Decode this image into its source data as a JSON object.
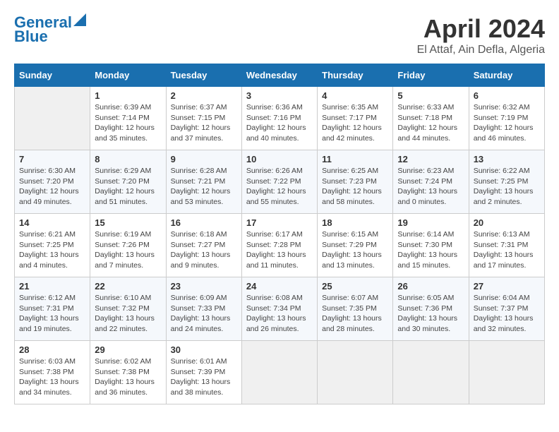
{
  "header": {
    "logo_line1": "General",
    "logo_line2": "Blue",
    "title": "April 2024",
    "subtitle": "El Attaf, Ain Defla, Algeria"
  },
  "columns": [
    "Sunday",
    "Monday",
    "Tuesday",
    "Wednesday",
    "Thursday",
    "Friday",
    "Saturday"
  ],
  "weeks": [
    [
      {
        "day": "",
        "sunrise": "",
        "sunset": "",
        "daylight": ""
      },
      {
        "day": "1",
        "sunrise": "Sunrise: 6:39 AM",
        "sunset": "Sunset: 7:14 PM",
        "daylight": "Daylight: 12 hours and 35 minutes."
      },
      {
        "day": "2",
        "sunrise": "Sunrise: 6:37 AM",
        "sunset": "Sunset: 7:15 PM",
        "daylight": "Daylight: 12 hours and 37 minutes."
      },
      {
        "day": "3",
        "sunrise": "Sunrise: 6:36 AM",
        "sunset": "Sunset: 7:16 PM",
        "daylight": "Daylight: 12 hours and 40 minutes."
      },
      {
        "day": "4",
        "sunrise": "Sunrise: 6:35 AM",
        "sunset": "Sunset: 7:17 PM",
        "daylight": "Daylight: 12 hours and 42 minutes."
      },
      {
        "day": "5",
        "sunrise": "Sunrise: 6:33 AM",
        "sunset": "Sunset: 7:18 PM",
        "daylight": "Daylight: 12 hours and 44 minutes."
      },
      {
        "day": "6",
        "sunrise": "Sunrise: 6:32 AM",
        "sunset": "Sunset: 7:19 PM",
        "daylight": "Daylight: 12 hours and 46 minutes."
      }
    ],
    [
      {
        "day": "7",
        "sunrise": "Sunrise: 6:30 AM",
        "sunset": "Sunset: 7:20 PM",
        "daylight": "Daylight: 12 hours and 49 minutes."
      },
      {
        "day": "8",
        "sunrise": "Sunrise: 6:29 AM",
        "sunset": "Sunset: 7:20 PM",
        "daylight": "Daylight: 12 hours and 51 minutes."
      },
      {
        "day": "9",
        "sunrise": "Sunrise: 6:28 AM",
        "sunset": "Sunset: 7:21 PM",
        "daylight": "Daylight: 12 hours and 53 minutes."
      },
      {
        "day": "10",
        "sunrise": "Sunrise: 6:26 AM",
        "sunset": "Sunset: 7:22 PM",
        "daylight": "Daylight: 12 hours and 55 minutes."
      },
      {
        "day": "11",
        "sunrise": "Sunrise: 6:25 AM",
        "sunset": "Sunset: 7:23 PM",
        "daylight": "Daylight: 12 hours and 58 minutes."
      },
      {
        "day": "12",
        "sunrise": "Sunrise: 6:23 AM",
        "sunset": "Sunset: 7:24 PM",
        "daylight": "Daylight: 13 hours and 0 minutes."
      },
      {
        "day": "13",
        "sunrise": "Sunrise: 6:22 AM",
        "sunset": "Sunset: 7:25 PM",
        "daylight": "Daylight: 13 hours and 2 minutes."
      }
    ],
    [
      {
        "day": "14",
        "sunrise": "Sunrise: 6:21 AM",
        "sunset": "Sunset: 7:25 PM",
        "daylight": "Daylight: 13 hours and 4 minutes."
      },
      {
        "day": "15",
        "sunrise": "Sunrise: 6:19 AM",
        "sunset": "Sunset: 7:26 PM",
        "daylight": "Daylight: 13 hours and 7 minutes."
      },
      {
        "day": "16",
        "sunrise": "Sunrise: 6:18 AM",
        "sunset": "Sunset: 7:27 PM",
        "daylight": "Daylight: 13 hours and 9 minutes."
      },
      {
        "day": "17",
        "sunrise": "Sunrise: 6:17 AM",
        "sunset": "Sunset: 7:28 PM",
        "daylight": "Daylight: 13 hours and 11 minutes."
      },
      {
        "day": "18",
        "sunrise": "Sunrise: 6:15 AM",
        "sunset": "Sunset: 7:29 PM",
        "daylight": "Daylight: 13 hours and 13 minutes."
      },
      {
        "day": "19",
        "sunrise": "Sunrise: 6:14 AM",
        "sunset": "Sunset: 7:30 PM",
        "daylight": "Daylight: 13 hours and 15 minutes."
      },
      {
        "day": "20",
        "sunrise": "Sunrise: 6:13 AM",
        "sunset": "Sunset: 7:31 PM",
        "daylight": "Daylight: 13 hours and 17 minutes."
      }
    ],
    [
      {
        "day": "21",
        "sunrise": "Sunrise: 6:12 AM",
        "sunset": "Sunset: 7:31 PM",
        "daylight": "Daylight: 13 hours and 19 minutes."
      },
      {
        "day": "22",
        "sunrise": "Sunrise: 6:10 AM",
        "sunset": "Sunset: 7:32 PM",
        "daylight": "Daylight: 13 hours and 22 minutes."
      },
      {
        "day": "23",
        "sunrise": "Sunrise: 6:09 AM",
        "sunset": "Sunset: 7:33 PM",
        "daylight": "Daylight: 13 hours and 24 minutes."
      },
      {
        "day": "24",
        "sunrise": "Sunrise: 6:08 AM",
        "sunset": "Sunset: 7:34 PM",
        "daylight": "Daylight: 13 hours and 26 minutes."
      },
      {
        "day": "25",
        "sunrise": "Sunrise: 6:07 AM",
        "sunset": "Sunset: 7:35 PM",
        "daylight": "Daylight: 13 hours and 28 minutes."
      },
      {
        "day": "26",
        "sunrise": "Sunrise: 6:05 AM",
        "sunset": "Sunset: 7:36 PM",
        "daylight": "Daylight: 13 hours and 30 minutes."
      },
      {
        "day": "27",
        "sunrise": "Sunrise: 6:04 AM",
        "sunset": "Sunset: 7:37 PM",
        "daylight": "Daylight: 13 hours and 32 minutes."
      }
    ],
    [
      {
        "day": "28",
        "sunrise": "Sunrise: 6:03 AM",
        "sunset": "Sunset: 7:38 PM",
        "daylight": "Daylight: 13 hours and 34 minutes."
      },
      {
        "day": "29",
        "sunrise": "Sunrise: 6:02 AM",
        "sunset": "Sunset: 7:38 PM",
        "daylight": "Daylight: 13 hours and 36 minutes."
      },
      {
        "day": "30",
        "sunrise": "Sunrise: 6:01 AM",
        "sunset": "Sunset: 7:39 PM",
        "daylight": "Daylight: 13 hours and 38 minutes."
      },
      {
        "day": "",
        "sunrise": "",
        "sunset": "",
        "daylight": ""
      },
      {
        "day": "",
        "sunrise": "",
        "sunset": "",
        "daylight": ""
      },
      {
        "day": "",
        "sunrise": "",
        "sunset": "",
        "daylight": ""
      },
      {
        "day": "",
        "sunrise": "",
        "sunset": "",
        "daylight": ""
      }
    ]
  ]
}
